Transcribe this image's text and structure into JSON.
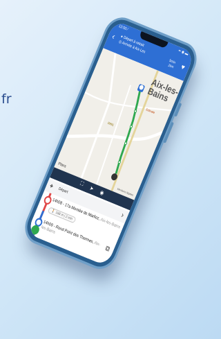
{
  "background": {
    "partial_text": "fr"
  },
  "status": {
    "time": "13:50 ⁄",
    "right": "▪▪ ◉ ▬"
  },
  "header": {
    "back_icon": "chevron-left-icon",
    "title_line1": "● Départ à retrait",
    "title_line2": "◎ Arrivée à Aix-Les",
    "right_line1": "5min",
    "right_line2": "2km"
  },
  "map": {
    "city_line1": "Aix-les-",
    "city_line2": "Bains",
    "poi_label": "Estivale",
    "road_label": "D991",
    "start_marker": "⬤",
    "plans_label": "Plans",
    "legal": "Mentions légales"
  },
  "steps": {
    "departure_label": "Départ",
    "step1_text": "14h08 - 17a Montée de Marlioz,",
    "step1_city": "Aix-les-Bains",
    "walk_text": "🚶 168 m | 2 min",
    "step2_text": "14h09 - Rond Point des Thermes,",
    "step2_city": "Aix-les-Bains"
  },
  "colors": {
    "accent": "#2e6fd4",
    "route": "#2fa84f",
    "rail": "#e04848",
    "dark_bar": "#20344f"
  }
}
